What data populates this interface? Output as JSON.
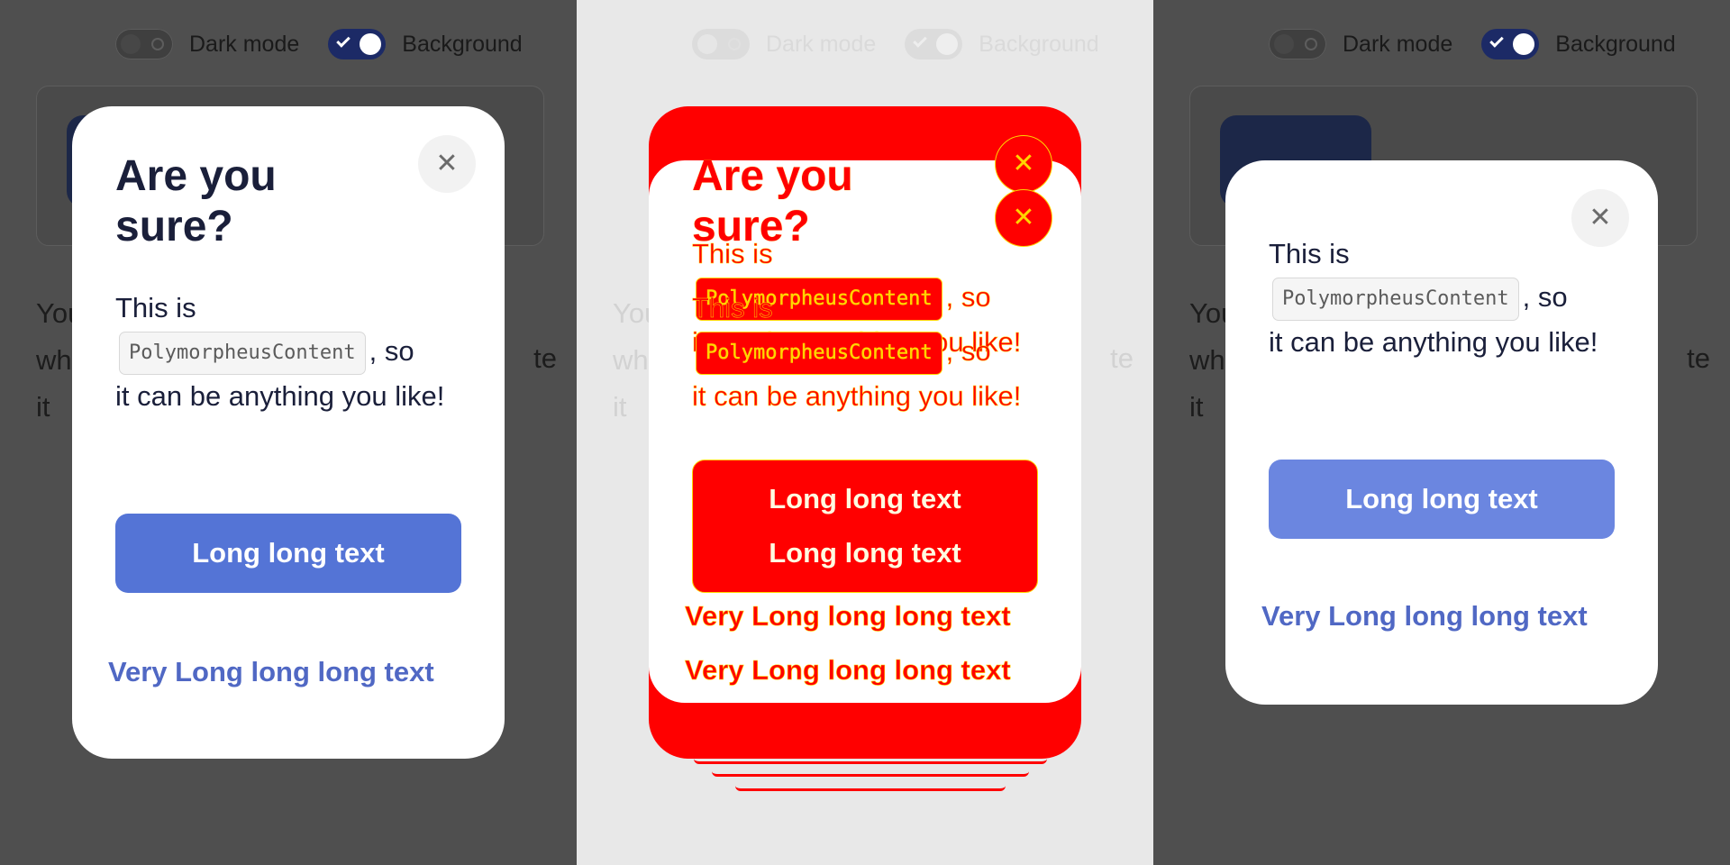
{
  "toolbar": {
    "dark_mode_label": "Dark mode",
    "background_label": "Background"
  },
  "demo": {
    "left_text": "You\nwh\nit",
    "right_fragment": "te"
  },
  "dialog": {
    "title": "Are you sure?",
    "body_before": "This is",
    "code_label": "PolymorpheusContent",
    "body_after_code": ", so",
    "body_end": "it can be anything you like!",
    "primary_label": "Long long text",
    "secondary_label": "Very Long long long text",
    "close_icon": "close-icon"
  },
  "colors": {
    "primary": "#5474d6",
    "secondary_text": "#5068c4",
    "title": "#1a1f3a",
    "toggle_on": "#1c2a66",
    "highlight_red": "#ff0000",
    "highlight_outline": "#ffd500"
  }
}
